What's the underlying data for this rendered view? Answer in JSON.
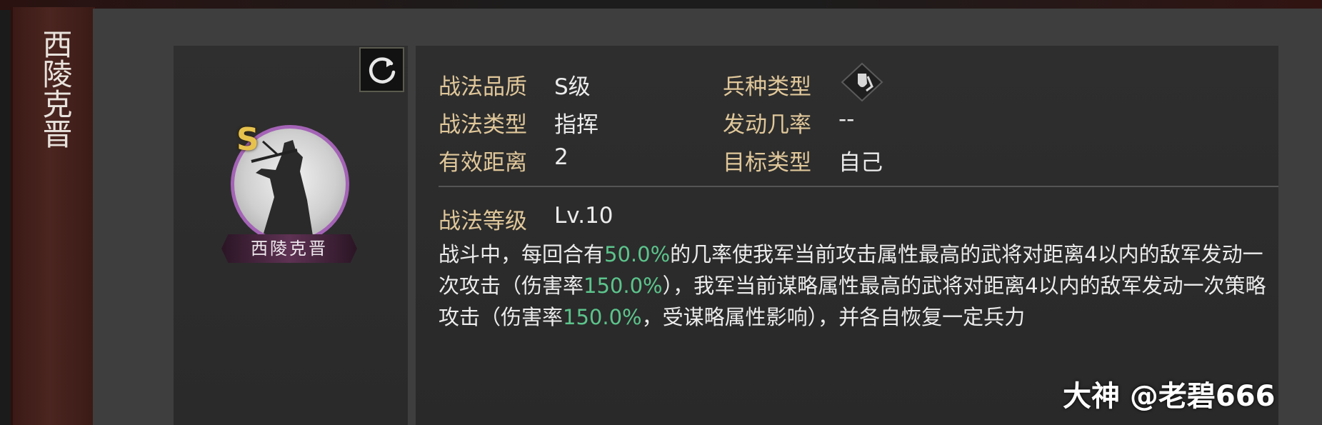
{
  "general": {
    "name_vertical": "西陵克晋",
    "name_plate": "西陵克晋",
    "grade_badge": "S"
  },
  "attributes": {
    "quality_label": "战法品质",
    "quality_value": "S级",
    "unit_type_label": "兵种类型",
    "unit_type_icon": "shield-leaf-icon",
    "tactic_type_label": "战法类型",
    "tactic_type_value": "指挥",
    "trigger_rate_label": "发动几率",
    "trigger_rate_value": "--",
    "range_label": "有效距离",
    "range_value": "2",
    "target_label": "目标类型",
    "target_value": "自己",
    "level_label": "战法等级",
    "level_value": "Lv.10"
  },
  "description": {
    "p1": "战斗中，每回合有",
    "h1": "50.0%",
    "p2": "的几率使我军当前攻击属性最高的武将对距离4以内的敌军发动一次攻击（伤害率",
    "h2": "150.0%",
    "p3": "），我军当前谋略属性最高的武将对距离4以内的敌军发动一次策略攻击（伤害率",
    "h3": "150.0%",
    "p4": "，受谋略属性影响），并各自恢复一定兵力"
  },
  "watermark": "大神 @老碧666",
  "colors": {
    "label": "#e0c79a",
    "value": "#ececec",
    "highlight": "#5cc48c",
    "portrait_ring": "#a463b6",
    "grade": "#e6c24d"
  }
}
